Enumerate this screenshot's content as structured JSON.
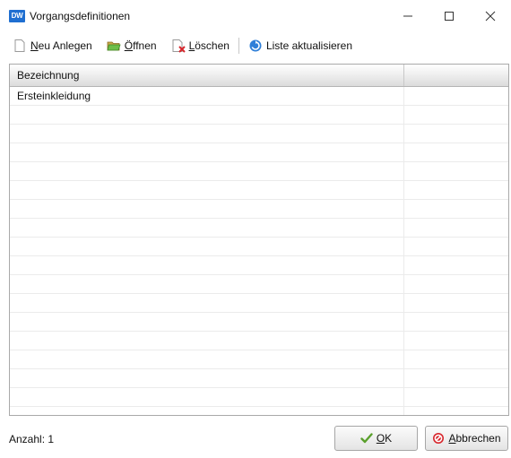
{
  "window": {
    "title": "Vorgangsdefinitionen",
    "app_icon_text": "DW"
  },
  "toolbar": {
    "new_label_mnemonic": "N",
    "new_label_rest": "eu Anlegen",
    "open_label_mnemonic": "Ö",
    "open_label_rest": "ffnen",
    "delete_label_mnemonic": "L",
    "delete_label_rest": "öschen",
    "refresh_label": "Liste aktualisieren"
  },
  "grid": {
    "columns": [
      "Bezeichnung",
      ""
    ],
    "rows": [
      "Ersteinkleidung",
      "",
      "",
      "",
      "",
      "",
      "",
      "",
      "",
      "",
      "",
      "",
      "",
      "",
      "",
      "",
      "",
      ""
    ]
  },
  "status": {
    "count_text": "Anzahl: 1"
  },
  "buttons": {
    "ok_mnemonic": "O",
    "ok_rest": "K",
    "cancel_mnemonic": "A",
    "cancel_rest": "bbrechen"
  },
  "colors": {
    "app_icon": "#1f6fd1",
    "ok_check": "#5aa02c",
    "cancel_icon": "#d7262c",
    "refresh_icon": "#2f7fd8",
    "delete_icon": "#d7262c"
  },
  "icons": {
    "new": "blank-document-icon",
    "open": "folder-open-icon",
    "delete": "document-delete-icon",
    "refresh": "refresh-icon",
    "ok": "checkmark-icon",
    "cancel": "prohibited-icon"
  }
}
